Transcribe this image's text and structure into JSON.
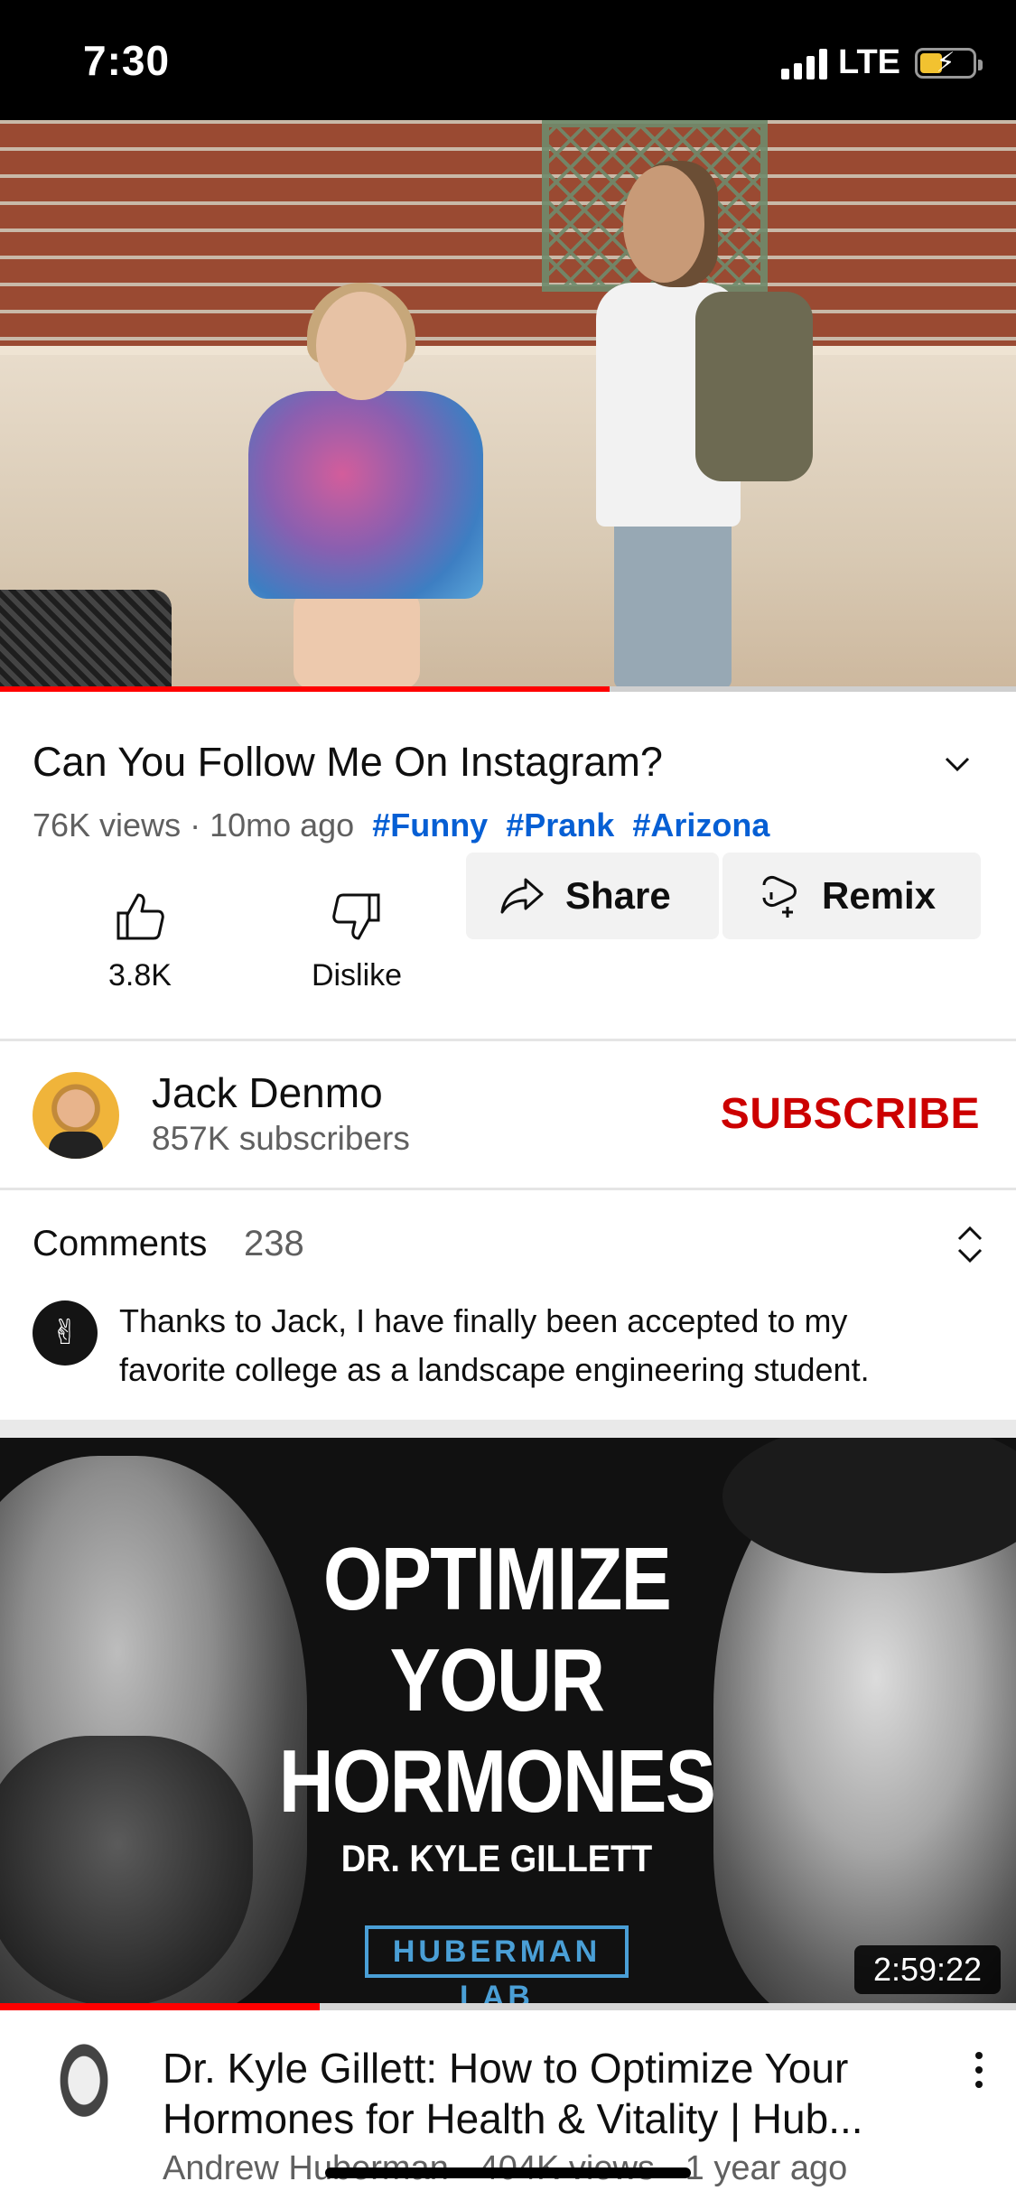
{
  "status_bar": {
    "time": "7:30",
    "network": "LTE",
    "signal_icon": "signal-bars-icon",
    "battery_icon": "battery-charging-icon",
    "battery_color": "#f2c230"
  },
  "player": {
    "progress_fraction": 0.6,
    "progress_color": "#ff0000"
  },
  "video": {
    "title": "Can You Follow Me On Instagram?",
    "meta": "76K views · 10mo ago",
    "hashtags": [
      "#Funny",
      "#Prank",
      "#Arizona"
    ],
    "hashtag_color": "#065fd4"
  },
  "actions": {
    "like_count": "3.8K",
    "dislike_label": "Dislike",
    "share_label": "Share",
    "remix_label": "Remix"
  },
  "channel": {
    "name": "Jack Denmo",
    "subscribers": "857K subscribers",
    "subscribe_label": "SUBSCRIBE",
    "subscribe_color": "#cc0000"
  },
  "comments": {
    "label": "Comments",
    "count": "238",
    "top_comment": "Thanks to Jack, I have finally been accepted to my favorite college as a landscape engineering student.",
    "commenter_avatar_glyph": "✌"
  },
  "next_video": {
    "thumbnail_headline_lines": [
      "OPTIMIZE",
      "YOUR",
      "HORMONES"
    ],
    "thumbnail_guest": "DR. KYLE GILLETT",
    "thumbnail_brand": "HUBERMAN LAB",
    "duration": "2:59:22",
    "progress_fraction": 0.315,
    "title_line1": "Dr. Kyle Gillett: How to Optimize Your",
    "title_line2": "Hormones for Health & Vitality | Hub...",
    "meta": "Andrew Huberman · 404K views · 1 year ago"
  }
}
